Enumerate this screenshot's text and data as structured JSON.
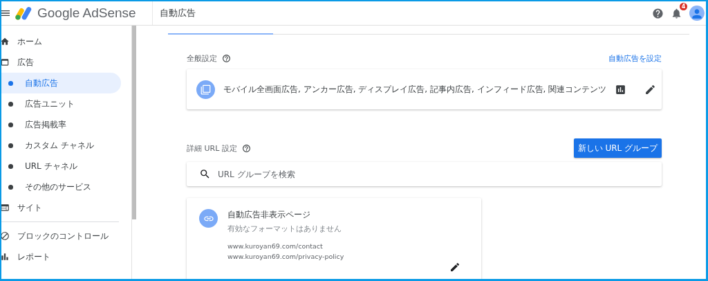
{
  "header": {
    "brand": "Google AdSense",
    "page_title": "自動広告",
    "notification_count": "4"
  },
  "sidebar": {
    "items": [
      {
        "kind": "section",
        "label": "ホーム",
        "selected": false
      },
      {
        "kind": "section",
        "label": "広告",
        "selected": false
      },
      {
        "kind": "sub",
        "label": "自動広告",
        "selected": true
      },
      {
        "kind": "sub",
        "label": "広告ユニット",
        "selected": false
      },
      {
        "kind": "sub",
        "label": "広告掲載率",
        "selected": false
      },
      {
        "kind": "sub",
        "label": "カスタム チャネル",
        "selected": false
      },
      {
        "kind": "sub",
        "label": "URL チャネル",
        "selected": false
      },
      {
        "kind": "sub",
        "label": "その他のサービス",
        "selected": false
      },
      {
        "kind": "section",
        "label": "サイト",
        "selected": false
      },
      {
        "kind": "divider"
      },
      {
        "kind": "section",
        "label": "ブロックのコントロール",
        "selected": false
      },
      {
        "kind": "section",
        "label": "レポート",
        "selected": false
      }
    ]
  },
  "general": {
    "title": "全般設定",
    "link": "自動広告を設定",
    "summary": "モバイル全画面広告, アンカー広告, ディスプレイ広告, 記事内広告, インフィード広告, 関連コンテンツ"
  },
  "url_settings": {
    "title": "詳細 URL 設定",
    "button": "新しい URL グループ",
    "search": {
      "placeholder": "URL グループを検索"
    },
    "groups": [
      {
        "title": "自動広告非表示ページ",
        "subtitle": "有効なフォーマットはありません",
        "urls": [
          "www.kuroyan69.com/contact",
          "www.kuroyan69.com/privacy-policy"
        ]
      }
    ]
  }
}
